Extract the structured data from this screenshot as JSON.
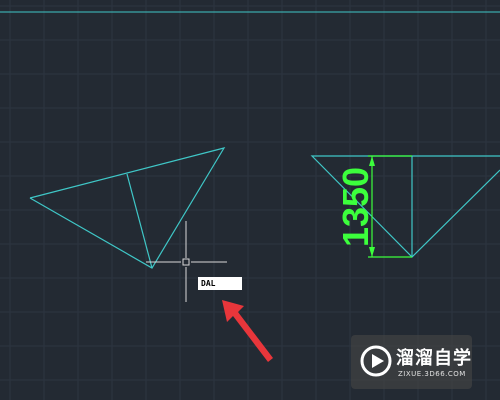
{
  "canvas": {
    "background": "#232a33",
    "grid_color": "#2c3540",
    "line_color": "#3fc7c7",
    "dimension_color": "#3cff3c",
    "cursor_color": "#d8d8d8",
    "arrow_color": "#e8363b"
  },
  "drawing": {
    "dimension_value": "1350"
  },
  "command_line": {
    "input_value": "DAL"
  },
  "watermark": {
    "title": "溜溜自学",
    "subtitle": "ZIXUE.3D66.COM",
    "logo_icon": "play-logo-icon"
  }
}
